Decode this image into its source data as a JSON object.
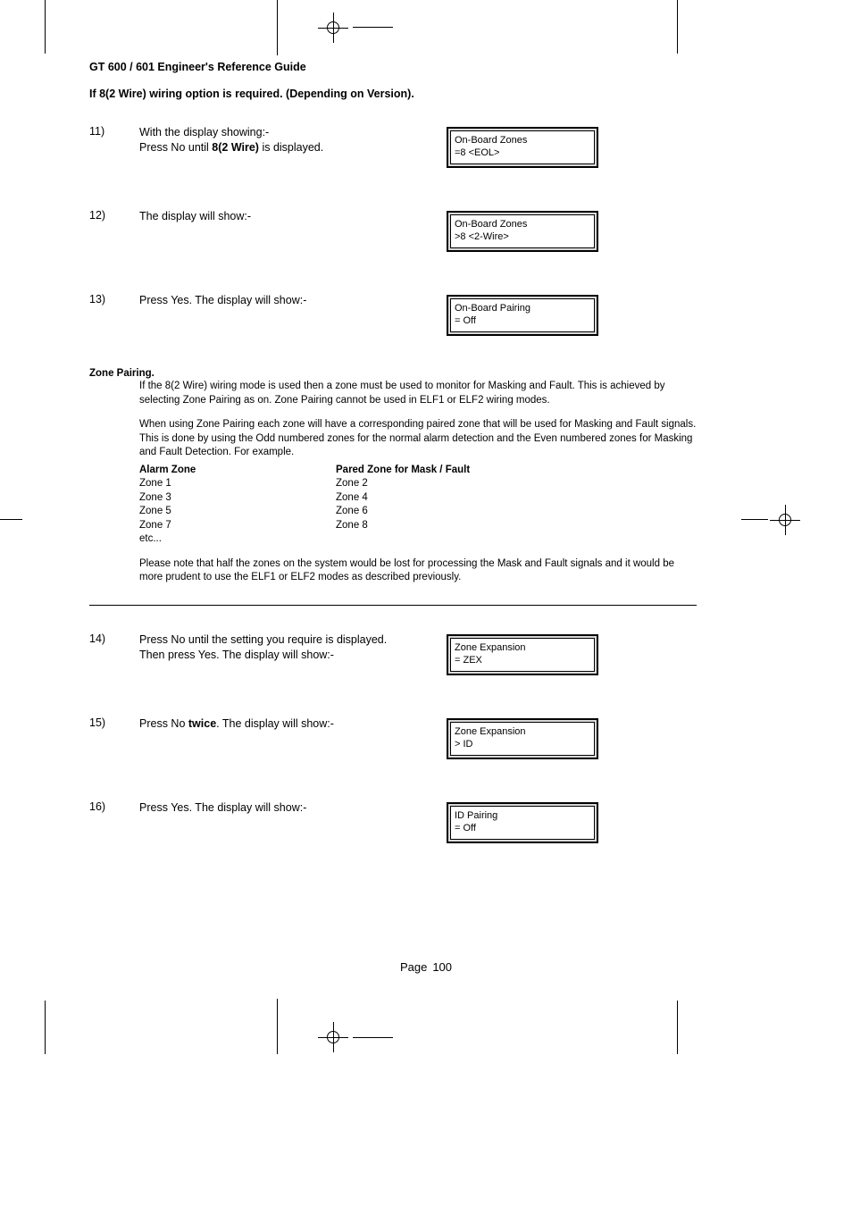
{
  "header": {
    "doc_title": "GT 600 / 601 Engineer's Reference Guide",
    "section_title": "If  8(2 Wire) wiring option is required. (Depending on Version)."
  },
  "steps_a": [
    {
      "num": "11)",
      "text_pre": "With the display showing:-\nPress No until ",
      "text_bold": "8(2 Wire)",
      "text_post": " is displayed.",
      "display_l1": "On-Board Zones",
      "display_l2": "=8 <EOL>"
    },
    {
      "num": "12)",
      "text_pre": "The display will show:-",
      "text_bold": "",
      "text_post": "",
      "display_l1": "On-Board Zones",
      "display_l2": ">8 <2-Wire>"
    },
    {
      "num": "13)",
      "text_pre": "Press Yes. The display will show:-",
      "text_bold": "",
      "text_post": "",
      "display_l1": "On-Board Pairing",
      "display_l2": "= Off"
    }
  ],
  "zone_pairing": {
    "title": "Zone Pairing.",
    "para1": "If the 8(2 Wire) wiring mode is used then a zone must be used to monitor for Masking and Fault. This is achieved by selecting Zone Pairing as on. Zone Pairing cannot be used in ELF1 or ELF2 wiring modes.",
    "para2": "When using Zone Pairing each zone will have a corresponding paired zone that will be used for Masking and Fault signals. This is done by using the Odd numbered zones for the normal alarm detection and the Even numbered zones for Masking and Fault Detection. For example.",
    "table_hdr1": "Alarm Zone",
    "table_hdr2": "Pared Zone for Mask / Fault",
    "col1": [
      "Zone 1",
      "Zone 3",
      "Zone 5",
      "Zone 7",
      "etc..."
    ],
    "col2": [
      "Zone 2",
      "Zone 4",
      "Zone 6",
      "Zone 8"
    ],
    "para3": "Please note that half the zones on the system would be lost for processing the Mask and Fault signals and it would be more prudent to use the ELF1 or ELF2 modes as described previously."
  },
  "steps_b": [
    {
      "num": "14)",
      "text_pre": "Press No until the setting you require is displayed.\nThen press Yes. The display will show:-",
      "text_bold": "",
      "text_post": "",
      "display_l1": "Zone Expansion",
      "display_l2": "= ZEX"
    },
    {
      "num": "15)",
      "text_pre": "Press No ",
      "text_bold": "twice",
      "text_post": ". The display will show:-",
      "display_l1": "Zone Expansion",
      "display_l2": "> ID"
    },
    {
      "num": "16)",
      "text_pre": "Press Yes. The display will show:-",
      "text_bold": "",
      "text_post": "",
      "display_l1": "ID  Pairing",
      "display_l2": "= Off"
    }
  ],
  "footer": {
    "label": "Page",
    "number": "100"
  }
}
